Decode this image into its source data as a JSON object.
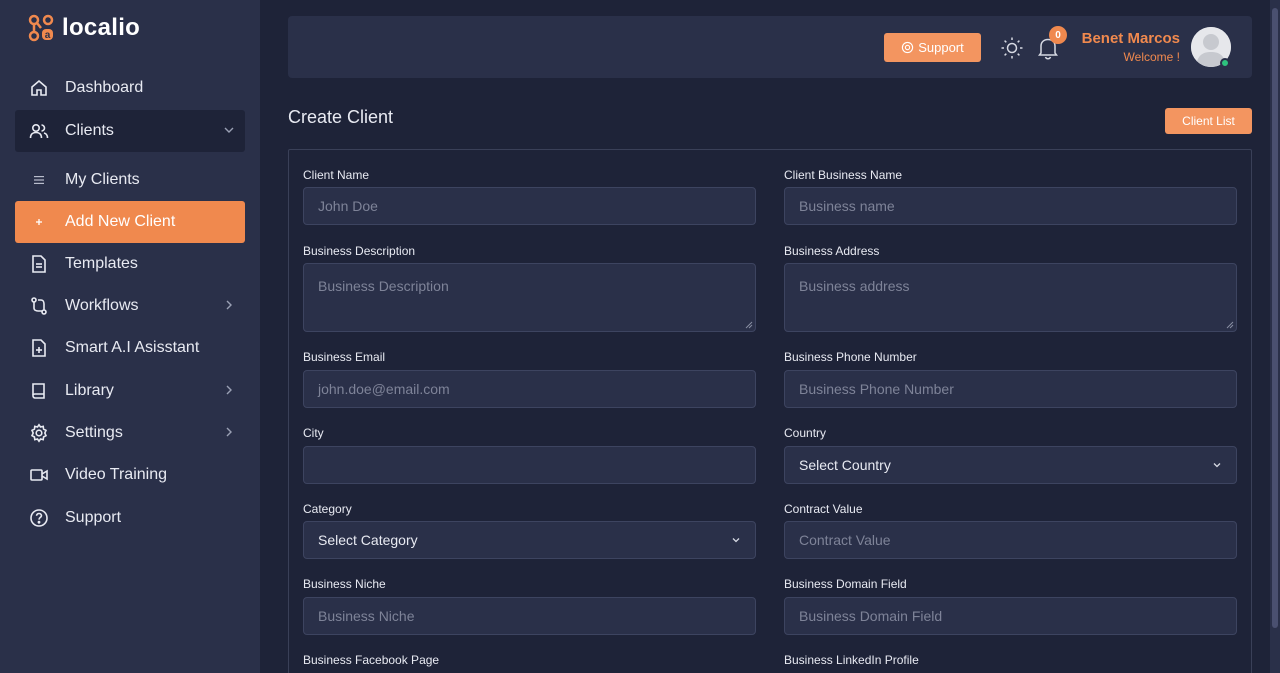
{
  "brand": {
    "name": "localio"
  },
  "sidebar": {
    "items": [
      {
        "label": "Dashboard"
      },
      {
        "label": "Clients"
      },
      {
        "label": "My Clients"
      },
      {
        "label": "Add New Client"
      },
      {
        "label": "Templates"
      },
      {
        "label": "Workflows"
      },
      {
        "label": "Smart A.I Asisstant"
      },
      {
        "label": "Library"
      },
      {
        "label": "Settings"
      },
      {
        "label": "Video Training"
      },
      {
        "label": "Support"
      }
    ]
  },
  "header": {
    "support_label": "Support",
    "notifications_count": "0",
    "user_name": "Benet Marcos",
    "user_greeting": "Welcome !"
  },
  "main": {
    "title": "Create Client",
    "client_list_label": "Client List",
    "fields": {
      "client_name": {
        "label": "Client Name",
        "placeholder": "John Doe"
      },
      "client_business_name": {
        "label": "Client Business Name",
        "placeholder": "Business name"
      },
      "business_description": {
        "label": "Business Description",
        "placeholder": "Business Description"
      },
      "business_address": {
        "label": "Business Address",
        "placeholder": "Business address"
      },
      "business_email": {
        "label": "Business Email",
        "placeholder": "john.doe@email.com"
      },
      "business_phone": {
        "label": "Business Phone Number",
        "placeholder": "Business Phone Number"
      },
      "city": {
        "label": "City",
        "placeholder": ""
      },
      "country": {
        "label": "Country",
        "value": "Select Country"
      },
      "category": {
        "label": "Category",
        "value": "Select Category"
      },
      "contract_value": {
        "label": "Contract Value",
        "placeholder": "Contract Value"
      },
      "business_niche": {
        "label": "Business Niche",
        "placeholder": "Business Niche"
      },
      "business_domain_field": {
        "label": "Business Domain Field",
        "placeholder": "Business Domain Field"
      },
      "business_facebook": {
        "label": "Business Facebook Page"
      },
      "business_linkedin": {
        "label": "Business LinkedIn Profile"
      }
    }
  },
  "colors": {
    "accent": "#f0894e",
    "sidebar_bg": "#2a3049",
    "page_bg": "#1e2338",
    "online": "#2ec27e"
  }
}
